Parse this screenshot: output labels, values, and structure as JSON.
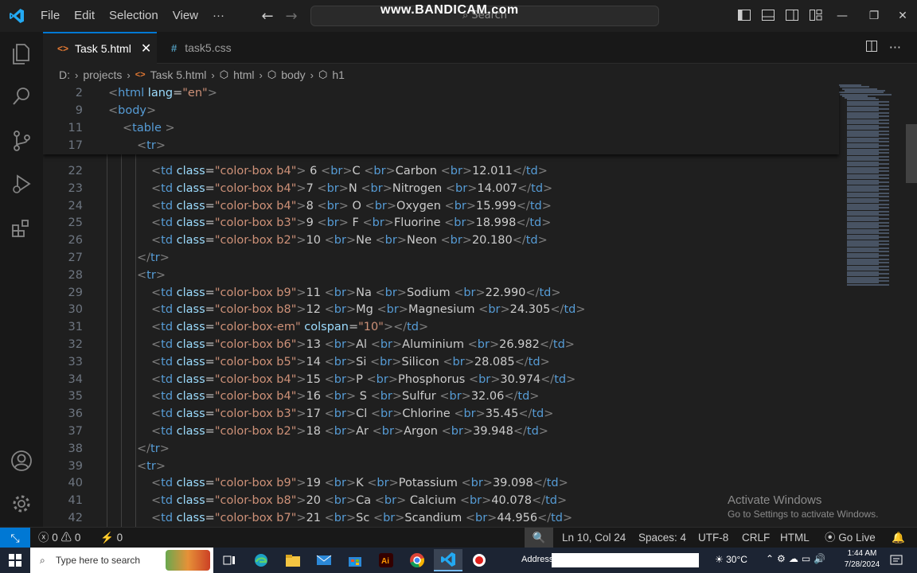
{
  "titlebar": {
    "menu": [
      "File",
      "Edit",
      "Selection",
      "View",
      "···"
    ],
    "search_placeholder": "Search",
    "watermark": "www.BANDICAM.com"
  },
  "tabs": [
    {
      "label": "Task 5.html",
      "icon": "html-file-icon",
      "active": true
    },
    {
      "label": "task5.css",
      "icon": "css-file-icon",
      "active": false
    }
  ],
  "breadcrumb": [
    "D:",
    "projects",
    "Task 5.html",
    "html",
    "body",
    "h1"
  ],
  "sticky_lines": [
    {
      "ln": "2",
      "indent": 0,
      "open": "<",
      "tag": "html",
      "attrs": [
        {
          "name": "lang",
          "value": "\"en\""
        }
      ],
      "close": ">"
    },
    {
      "ln": "9",
      "indent": 0,
      "open": "<",
      "tag": "body",
      "attrs": [],
      "close": ">"
    },
    {
      "ln": "11",
      "indent": 1,
      "open": "<",
      "tag": "table",
      "attrs": [],
      "close": " >"
    },
    {
      "ln": "17",
      "indent": 2,
      "open": "<",
      "tag": "tr",
      "attrs": [],
      "close": ">"
    }
  ],
  "lines": [
    {
      "ln": "22",
      "indent": 3,
      "cls": "\"color-box b4\"",
      "content": [
        " 6 ",
        "C ",
        "Carbon ",
        "12.011"
      ],
      "colspan": null
    },
    {
      "ln": "23",
      "indent": 3,
      "cls": "\"color-box b4\"",
      "content": [
        "7 ",
        "N ",
        "Nitrogen ",
        "14.007"
      ],
      "colspan": null
    },
    {
      "ln": "24",
      "indent": 3,
      "cls": "\"color-box b4\"",
      "content": [
        "8 ",
        " O ",
        "Oxygen ",
        "15.999"
      ],
      "colspan": null
    },
    {
      "ln": "25",
      "indent": 3,
      "cls": "\"color-box b3\"",
      "content": [
        "9 ",
        " F ",
        "Fluorine ",
        "18.998"
      ],
      "colspan": null
    },
    {
      "ln": "26",
      "indent": 3,
      "cls": "\"color-box b2\"",
      "content": [
        "10 ",
        "Ne ",
        "Neon ",
        "20.180"
      ],
      "colspan": null
    },
    {
      "ln": "27",
      "indent": 2,
      "closetr": true
    },
    {
      "ln": "28",
      "indent": 2,
      "opentr": true
    },
    {
      "ln": "29",
      "indent": 3,
      "cls": "\"color-box b9\"",
      "content": [
        "11 ",
        "Na ",
        "Sodium ",
        "22.990"
      ],
      "colspan": null
    },
    {
      "ln": "30",
      "indent": 3,
      "cls": "\"color-box b8\"",
      "content": [
        "12 ",
        "Mg ",
        "Magnesium ",
        "24.305"
      ],
      "colspan": null
    },
    {
      "ln": "31",
      "indent": 3,
      "cls": "\"color-box-em\"",
      "content": null,
      "colspan": "\"10\""
    },
    {
      "ln": "32",
      "indent": 3,
      "cls": "\"color-box b6\"",
      "content": [
        "13 ",
        "Al ",
        "Aluminium ",
        "26.982"
      ],
      "colspan": null
    },
    {
      "ln": "33",
      "indent": 3,
      "cls": "\"color-box b5\"",
      "content": [
        "14 ",
        "Si ",
        "Silicon ",
        "28.085"
      ],
      "colspan": null
    },
    {
      "ln": "34",
      "indent": 3,
      "cls": "\"color-box b4\"",
      "content": [
        "15 ",
        "P ",
        "Phosphorus ",
        "30.974"
      ],
      "colspan": null
    },
    {
      "ln": "35",
      "indent": 3,
      "cls": "\"color-box b4\"",
      "content": [
        "16 ",
        " S ",
        "Sulfur ",
        "32.06"
      ],
      "colspan": null
    },
    {
      "ln": "36",
      "indent": 3,
      "cls": "\"color-box b3\"",
      "content": [
        "17 ",
        "Cl ",
        "Chlorine ",
        "35.45"
      ],
      "colspan": null
    },
    {
      "ln": "37",
      "indent": 3,
      "cls": "\"color-box b2\"",
      "content": [
        "18 ",
        "Ar ",
        "Argon ",
        "39.948"
      ],
      "colspan": null
    },
    {
      "ln": "38",
      "indent": 2,
      "closetr": true
    },
    {
      "ln": "39",
      "indent": 2,
      "opentr": true
    },
    {
      "ln": "40",
      "indent": 3,
      "cls": "\"color-box b9\"",
      "content": [
        "19 ",
        "K ",
        "Potassium ",
        "39.098"
      ],
      "colspan": null
    },
    {
      "ln": "41",
      "indent": 3,
      "cls": "\"color-box b8\"",
      "content": [
        "20 ",
        "Ca ",
        " Calcium ",
        "40.078"
      ],
      "colspan": null
    },
    {
      "ln": "42",
      "indent": 3,
      "cls": "\"color-box b7\"",
      "content": [
        "21 ",
        "Sc ",
        "Scandium ",
        "44.956"
      ],
      "colspan": null
    }
  ],
  "activate_windows": {
    "title": "Activate Windows",
    "subtitle": "Go to Settings to activate Windows."
  },
  "statusbar": {
    "errors": "0",
    "warnings": "0",
    "ports": "0",
    "position": "Ln 10, Col 24",
    "spaces": "Spaces: 4",
    "encoding": "UTF-8",
    "eol": "CRLF",
    "language": "HTML",
    "golive": "Go Live"
  },
  "taskbar": {
    "search_placeholder": "Type here to search",
    "address_label": "Address",
    "temperature": "30°C",
    "time": "1:44 AM",
    "date": "7/28/2024"
  },
  "colors": {
    "accent": "#0078d4",
    "tag": "#569cd6",
    "attr": "#9cdcfe",
    "string": "#ce9178"
  }
}
